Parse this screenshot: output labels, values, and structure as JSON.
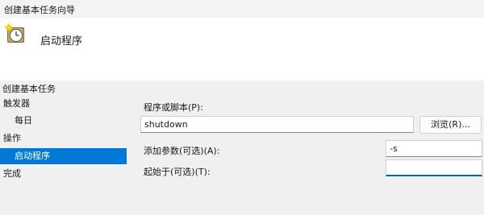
{
  "window": {
    "title": "创建基本任务向导"
  },
  "header": {
    "heading": "启动程序",
    "icon": "clock-wizard-icon"
  },
  "sidebar": {
    "section_title": "创建基本任务",
    "items": [
      {
        "label": "触发器"
      },
      {
        "label": "每日"
      },
      {
        "label": "操作"
      },
      {
        "label": "启动程序",
        "selected": true
      },
      {
        "label": "完成"
      }
    ]
  },
  "form": {
    "program_label": "程序或脚本(P):",
    "program_value": "shutdown",
    "browse_label": "浏览(R)...",
    "args_label": "添加参数(可选)(A):",
    "args_value": "-s",
    "startin_label": "起始于(可选)(T):",
    "startin_value": ""
  },
  "colors": {
    "accent": "#0078d7",
    "background": "#f0f0f0"
  }
}
